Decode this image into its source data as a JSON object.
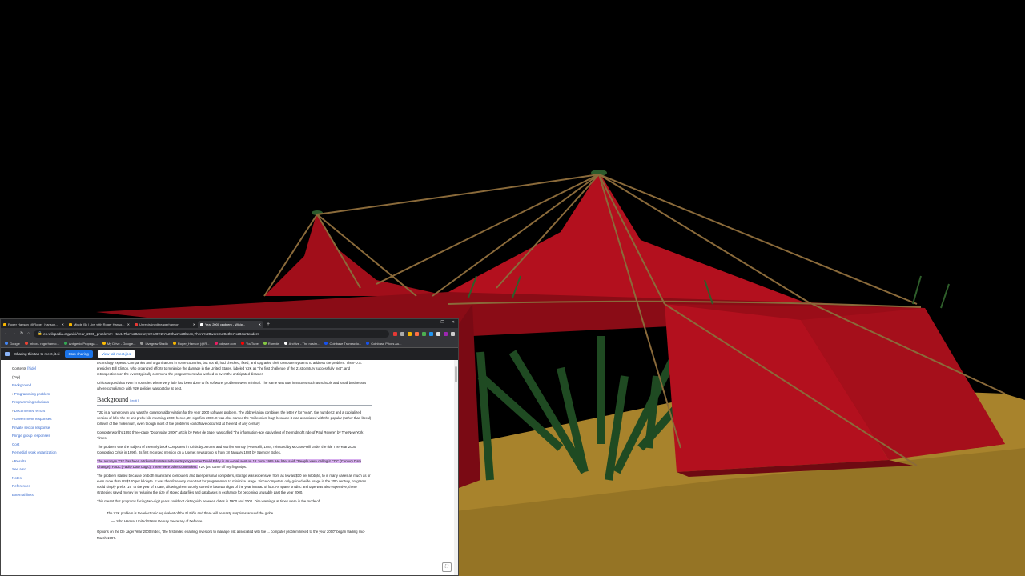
{
  "scene": {
    "description_icons": [
      "red-tent",
      "tent-pole",
      "rope",
      "sand-ground"
    ],
    "colors": {
      "sky": "#000000",
      "tent": "#b3101e",
      "tent_dark": "#6e0a12",
      "ground": "#a8832c",
      "pole": "#1f4a22",
      "rope": "#8a6a3a"
    }
  },
  "browser": {
    "tabs": [
      {
        "label": "Roger Hanson (@Roger_Hanson...",
        "icon": "x-icon"
      },
      {
        "label": "Minds (5) | Live with Roger Hanso...",
        "icon": "minds-icon"
      },
      {
        "label": "Unrestrainedtheagerhanson",
        "icon": "record-icon"
      },
      {
        "label": "Year 2000 problem - Wikip...",
        "icon": "wikipedia-icon"
      }
    ],
    "new_tab": "+",
    "window_controls": [
      "–",
      "❐",
      "✕"
    ],
    "url": "en.wikipedia.org/wiki/Year_2000_problem#:~:text=The%20acronym%20Y2K%20has%20been,There%20were%20other%20contenders",
    "bookmarks": [
      "Google",
      "Inbox - rogerhanso...",
      "Antigenic Propaga...",
      "My Drive - Google...",
      "Livegrow Studio",
      "Roger_Hanson (@R...",
      "odysee.com",
      "YouTube",
      "Rumble",
      "Archive - The nasim...",
      "Coinbase Transactio...",
      "Coinbase Prices Au..."
    ],
    "sharing": {
      "text": "Sharing this tab to meet.jit.si",
      "stop_label": "Stop sharing",
      "view_label": "View tab meet.jit.si"
    }
  },
  "toc": {
    "title": "Contents",
    "hide": "[hide]",
    "items": [
      "(Top)",
      "Background",
      "Programming problem",
      "Programming solutions",
      "Documented errors",
      "Government responses",
      "Private sector response",
      "Fringe group responses",
      "Cost",
      "Remedial work organization",
      "Results",
      "See also",
      "Notes",
      "References",
      "External links"
    ]
  },
  "article": {
    "p0": "technology experts. Companies and organizations in some countries, but not all, had checked, fixed, and upgraded their computer systems to address the problem. Then-U.S. president Bill Clinton, who organized efforts to minimize the damage in the United States, labeled Y2K as \"the first challenge of the 21st century successfully met\", and retrospectives on the event typically commend the programmers who worked to avert the anticipated disaster.",
    "p1": "Critics argued that even in countries where very little had been done to fix software, problems were minimal. The same was true in sectors such as schools and small businesses where compliance with Y2K policies was patchy at best.",
    "h_background": "Background",
    "edit": "[ edit ]",
    "p2": "Y2K is a numeronym and was the common abbreviation for the year 2000 software problem. The abbreviation combines the letter Y for \"year\", the number 2 and a capitalized version of k for the SI unit prefix kilo meaning 1000; hence, 2K signifies 2000. It was also named the \"millennium bug\" because it was associated with the popular (rather than literal) rollover of the millennium, even though most of the problems could have occurred at the end of any century.",
    "p3": "Computerworld's 1993 three-page \"Doomsday 2000\" article by Peter de Jager was called \"the information-age equivalent of the midnight ride of Paul Revere\" by The New York Times.",
    "p4": "The problem was the subject of the early book Computers in Crisis by Jerome and Marilyn Murray (Petrocelli, 1984; reissued by McGraw-Hill under the title The Year 2000 Computing Crisis in 1996). Its first recorded mention on a Usenet newsgroup is from 18 January 1985 by Spencer Bolles.",
    "p5_hl": "The acronym Y2K has been attributed to Massachusetts programmer David Eddy in an e-mail sent on 12 June 1995. He later said, \"People were calling it CDC (Century Date Change), FADL (Faulty Date Logic). There were other contenders.",
    "p5_rest": " Y2K just came off my fingertips.\"",
    "p6": "The problem started because on both mainframe computers and later personal computers, storage was expensive, from as low as $10 per kilobyte, to in many cases as much as or even more than US$100 per kilobyte. It was therefore very important for programmers to minimize usage. Since computers only gained wide usage in the 20th century, programs could simply prefix \"19\" to the year of a date, allowing them to only store the last two digits of the year instead of four. As space on disc and tape was also expensive, these strategies saved money by reducing the size of stored data files and databases in exchange for becoming unusable past the year 2000.",
    "p7": "This meant that programs facing two-digit years could not distinguish between dates in 1900 and 2000. Dire warnings at times were in the mode of:",
    "quote": "The Y2K problem is the electronic equivalent of the El Niño and there will be nasty surprises around the globe.",
    "quote_by": "— John Hamre, United States Deputy Secretary of Defense",
    "p8": "Options on the De Jager Year 2000 Index, \"the first index enabling investors to manage risk associated with the ... computer problem linked to the year 2000\" began trading mid-March 1997."
  }
}
